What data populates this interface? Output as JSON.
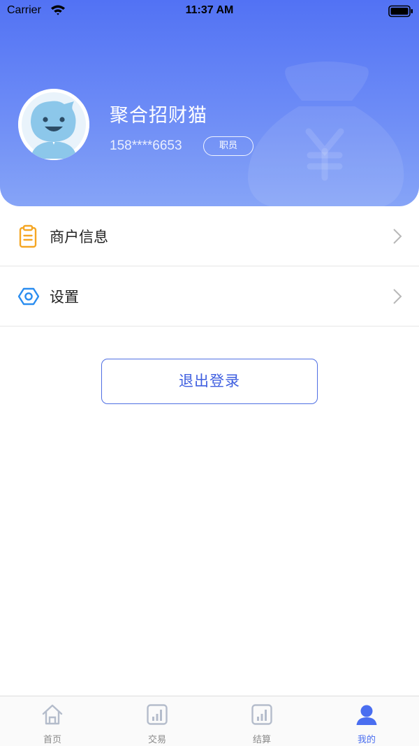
{
  "status_bar": {
    "carrier": "Carrier",
    "time": "11:37 AM"
  },
  "profile": {
    "name": "聚合招财猫",
    "phone": "158****6653",
    "role": "职员"
  },
  "menu": [
    {
      "label": "商户信息",
      "icon": "clipboard-icon"
    },
    {
      "label": "设置",
      "icon": "hexagon-settings-icon"
    }
  ],
  "logout": {
    "label": "退出登录"
  },
  "tabs": [
    {
      "label": "首页",
      "icon": "home-icon",
      "active": false
    },
    {
      "label": "交易",
      "icon": "bar-chart-icon",
      "active": false
    },
    {
      "label": "结算",
      "icon": "bar-chart-icon",
      "active": false
    },
    {
      "label": "我的",
      "icon": "user-icon",
      "active": true
    }
  ],
  "colors": {
    "accent": "#4a6ef0",
    "header_top": "#5272f4",
    "header_bottom": "#86a4f7",
    "clipboard": "#f5a623",
    "settings": "#2a8df0"
  }
}
